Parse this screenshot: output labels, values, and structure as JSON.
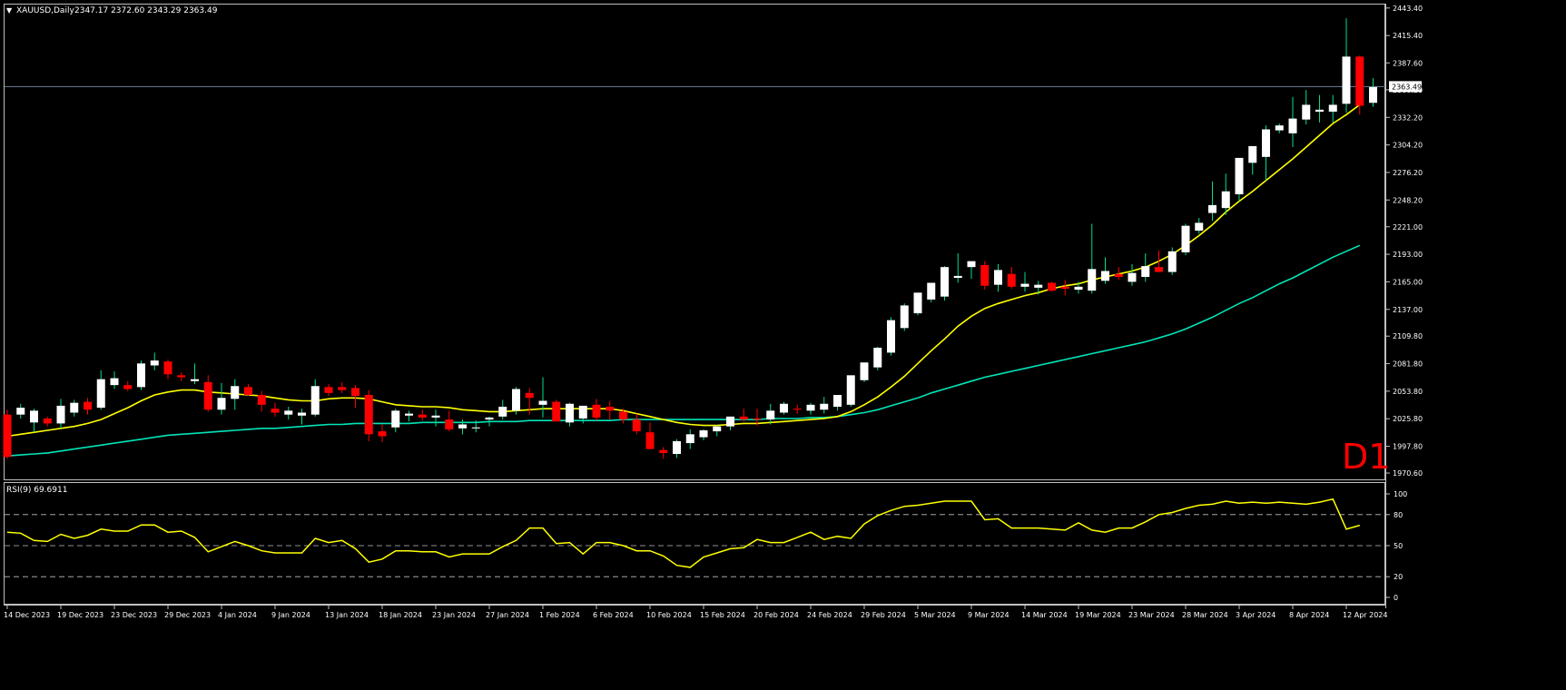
{
  "header": {
    "arrow": "▼",
    "symbol_tf": "XAUUSD,Daily",
    "ohlc_values": "2347.17 2372.60 2343.29 2363.49"
  },
  "watermark": "D1",
  "rsi_label": "RSI(9) 69.6911",
  "colors": {
    "background": "#000000",
    "axis": "#c0c0c0",
    "bear": "#ff0000",
    "bull": "#ffffff",
    "ma_fast": "#ffff00",
    "ma_slow": "#00e5b8",
    "rsi": "#ffff00",
    "price_line": "#6b7f99",
    "watermark": "#ff0000"
  },
  "chart_data": {
    "type": "candlestick",
    "symbol": "XAUUSD",
    "timeframe": "Daily",
    "last_price": 2363.49,
    "y_ticks": [
      1970.6,
      1997.8,
      2025.8,
      2053.8,
      2081.8,
      2109.8,
      2137.0,
      2165.0,
      2193.0,
      2221.0,
      2248.2,
      2276.2,
      2304.2,
      2332.2,
      2360.2,
      2387.6,
      2415.4,
      2443.4
    ],
    "ylim": [
      1966,
      2446
    ],
    "x_tick_labels": [
      {
        "i": 0,
        "label": "14 Dec 2023"
      },
      {
        "i": 4,
        "label": "19 Dec 2023"
      },
      {
        "i": 8,
        "label": "23 Dec 2023"
      },
      {
        "i": 12,
        "label": "29 Dec 2023"
      },
      {
        "i": 16,
        "label": "4 Jan 2024"
      },
      {
        "i": 20,
        "label": "9 Jan 2024"
      },
      {
        "i": 24,
        "label": "13 Jan 2024"
      },
      {
        "i": 28,
        "label": "18 Jan 2024"
      },
      {
        "i": 32,
        "label": "23 Jan 2024"
      },
      {
        "i": 36,
        "label": "27 Jan 2024"
      },
      {
        "i": 40,
        "label": "1 Feb 2024"
      },
      {
        "i": 44,
        "label": "6 Feb 2024"
      },
      {
        "i": 48,
        "label": "10 Feb 2024"
      },
      {
        "i": 52,
        "label": "15 Feb 2024"
      },
      {
        "i": 56,
        "label": "20 Feb 2024"
      },
      {
        "i": 60,
        "label": "24 Feb 2024"
      },
      {
        "i": 64,
        "label": "29 Feb 2024"
      },
      {
        "i": 68,
        "label": "5 Mar 2024"
      },
      {
        "i": 72,
        "label": "9 Mar 2024"
      },
      {
        "i": 76,
        "label": "14 Mar 2024"
      },
      {
        "i": 80,
        "label": "19 Mar 2024"
      },
      {
        "i": 84,
        "label": "23 Mar 2024"
      },
      {
        "i": 88,
        "label": "28 Mar 2024"
      },
      {
        "i": 92,
        "label": "3 Apr 2024"
      },
      {
        "i": 96,
        "label": "8 Apr 2024"
      },
      {
        "i": 100,
        "label": "12 Apr 2024"
      }
    ],
    "candles": [
      [
        2030,
        2035,
        1985,
        1987
      ],
      [
        2030,
        2041,
        2026,
        2037
      ],
      [
        2022,
        2036,
        2012,
        2034
      ],
      [
        2026,
        2028,
        2018,
        2021
      ],
      [
        2021,
        2046,
        2016,
        2039
      ],
      [
        2032,
        2045,
        2028,
        2042
      ],
      [
        2043,
        2047,
        2030,
        2035
      ],
      [
        2037,
        2075,
        2035,
        2066
      ],
      [
        2060,
        2074,
        2056,
        2067
      ],
      [
        2060,
        2064,
        2054,
        2056
      ],
      [
        2058,
        2085,
        2055,
        2082
      ],
      [
        2080,
        2093,
        2075,
        2085
      ],
      [
        2084,
        2086,
        2066,
        2071
      ],
      [
        2070,
        2073,
        2064,
        2068
      ],
      [
        2064,
        2082,
        2061,
        2066
      ],
      [
        2063,
        2070,
        2033,
        2035
      ],
      [
        2035,
        2062,
        2030,
        2047
      ],
      [
        2046,
        2066,
        2035,
        2059
      ],
      [
        2058,
        2061,
        2049,
        2050
      ],
      [
        2050,
        2054,
        2033,
        2040
      ],
      [
        2036,
        2042,
        2028,
        2032
      ],
      [
        2030,
        2038,
        2025,
        2034
      ],
      [
        2029,
        2036,
        2020,
        2032
      ],
      [
        2030,
        2066,
        2028,
        2059
      ],
      [
        2058,
        2061,
        2049,
        2052
      ],
      [
        2058,
        2063,
        2052,
        2055
      ],
      [
        2057,
        2060,
        2037,
        2049
      ],
      [
        2050,
        2055,
        2003,
        2010
      ],
      [
        2013,
        2020,
        2002,
        2008
      ],
      [
        2017,
        2036,
        2012,
        2034
      ],
      [
        2029,
        2034,
        2023,
        2031
      ],
      [
        2030,
        2035,
        2024,
        2027
      ],
      [
        2027,
        2035,
        2018,
        2029
      ],
      [
        2025,
        2034,
        2013,
        2015
      ],
      [
        2016,
        2025,
        2010,
        2020
      ],
      [
        2016,
        2024,
        2012,
        2017
      ],
      [
        2025,
        2028,
        2018,
        2027
      ],
      [
        2028,
        2045,
        2025,
        2038
      ],
      [
        2034,
        2058,
        2030,
        2056
      ],
      [
        2052,
        2057,
        2030,
        2047
      ],
      [
        2040,
        2068,
        2027,
        2044
      ],
      [
        2043,
        2045,
        2025,
        2023
      ],
      [
        2022,
        2042,
        2018,
        2041
      ],
      [
        2026,
        2037,
        2021,
        2039
      ],
      [
        2040,
        2046,
        2024,
        2027
      ],
      [
        2038,
        2044,
        2025,
        2034
      ],
      [
        2033,
        2036,
        2021,
        2025
      ],
      [
        2025,
        2031,
        2010,
        2013
      ],
      [
        2012,
        2022,
        1996,
        1995
      ],
      [
        1994,
        1997,
        1985,
        1991
      ],
      [
        1990,
        2005,
        1986,
        2003
      ],
      [
        2001,
        2015,
        1995,
        2010
      ],
      [
        2007,
        2015,
        2004,
        2014
      ],
      [
        2013,
        2019,
        2008,
        2018
      ],
      [
        2018,
        2028,
        2014,
        2028
      ],
      [
        2028,
        2036,
        2023,
        2025
      ],
      [
        2026,
        2036,
        2019,
        2025
      ],
      [
        2025,
        2041,
        2020,
        2034
      ],
      [
        2032,
        2043,
        2030,
        2041
      ],
      [
        2036,
        2040,
        2031,
        2035
      ],
      [
        2034,
        2042,
        2030,
        2040
      ],
      [
        2035,
        2048,
        2031,
        2041
      ],
      [
        2038,
        2050,
        2034,
        2050
      ],
      [
        2040,
        2060,
        2038,
        2070
      ],
      [
        2065,
        2083,
        2063,
        2083
      ],
      [
        2078,
        2099,
        2075,
        2098
      ],
      [
        2093,
        2129,
        2090,
        2126
      ],
      [
        2118,
        2143,
        2115,
        2141
      ],
      [
        2133,
        2153,
        2131,
        2154
      ],
      [
        2147,
        2162,
        2144,
        2164
      ],
      [
        2150,
        2181,
        2146,
        2180
      ],
      [
        2169,
        2194,
        2164,
        2171
      ],
      [
        2180,
        2183,
        2168,
        2186
      ],
      [
        2182,
        2186,
        2157,
        2161
      ],
      [
        2162,
        2183,
        2155,
        2177
      ],
      [
        2173,
        2180,
        2158,
        2160
      ],
      [
        2160,
        2175,
        2155,
        2163
      ],
      [
        2159,
        2166,
        2152,
        2162
      ],
      [
        2164,
        2165,
        2155,
        2156
      ],
      [
        2160,
        2167,
        2151,
        2158
      ],
      [
        2157,
        2165,
        2153,
        2160
      ],
      [
        2156,
        2224,
        2153,
        2178
      ],
      [
        2166,
        2190,
        2163,
        2176
      ],
      [
        2173,
        2180,
        2167,
        2170
      ],
      [
        2165,
        2183,
        2161,
        2174
      ],
      [
        2170,
        2194,
        2165,
        2181
      ],
      [
        2180,
        2197,
        2175,
        2175
      ],
      [
        2175,
        2200,
        2172,
        2196
      ],
      [
        2195,
        2224,
        2192,
        2222
      ],
      [
        2217,
        2230,
        2214,
        2225
      ],
      [
        2235,
        2267,
        2227,
        2243
      ],
      [
        2240,
        2275,
        2233,
        2257
      ],
      [
        2254,
        2288,
        2247,
        2291
      ],
      [
        2286,
        2300,
        2274,
        2303
      ],
      [
        2292,
        2324,
        2268,
        2320
      ],
      [
        2319,
        2326,
        2316,
        2324
      ],
      [
        2316,
        2353,
        2302,
        2331
      ],
      [
        2330,
        2360,
        2325,
        2345
      ],
      [
        2338,
        2355,
        2327,
        2340
      ],
      [
        2338,
        2355,
        2327,
        2345
      ],
      [
        2346,
        2433,
        2337,
        2394
      ],
      [
        2394,
        2395,
        2335,
        2344
      ],
      [
        2347,
        2372,
        2343,
        2363
      ]
    ],
    "ma_fast": [
      2008,
      2010,
      2012,
      2014,
      2016,
      2018,
      2021,
      2025,
      2031,
      2037,
      2044,
      2050,
      2053,
      2055,
      2055,
      2053,
      2052,
      2051,
      2050,
      2049,
      2047,
      2045,
      2044,
      2044,
      2046,
      2047,
      2047,
      2046,
      2043,
      2040,
      2039,
      2038,
      2038,
      2037,
      2035,
      2034,
      2033,
      2033,
      2034,
      2035,
      2036,
      2036,
      2036,
      2036,
      2036,
      2036,
      2034,
      2031,
      2028,
      2025,
      2022,
      2020,
      2019,
      2019,
      2020,
      2021,
      2021,
      2022,
      2023,
      2024,
      2025,
      2026,
      2028,
      2033,
      2040,
      2048,
      2058,
      2069,
      2082,
      2095,
      2107,
      2120,
      2130,
      2138,
      2143,
      2147,
      2151,
      2154,
      2158,
      2161,
      2163,
      2167,
      2170,
      2173,
      2176,
      2180,
      2186,
      2193,
      2202,
      2212,
      2223,
      2236,
      2247,
      2257,
      2268,
      2279,
      2290,
      2302,
      2314,
      2326,
      2335,
      2345
    ],
    "ma_slow": [
      1988,
      1989,
      1990,
      1991,
      1993,
      1995,
      1997,
      1999,
      2001,
      2003,
      2005,
      2007,
      2009,
      2010,
      2011,
      2012,
      2013,
      2014,
      2015,
      2016,
      2016,
      2017,
      2018,
      2019,
      2020,
      2020,
      2021,
      2021,
      2021,
      2021,
      2021,
      2022,
      2022,
      2022,
      2022,
      2022,
      2023,
      2023,
      2023,
      2024,
      2024,
      2024,
      2024,
      2024,
      2024,
      2024,
      2025,
      2025,
      2025,
      2025,
      2025,
      2025,
      2025,
      2025,
      2025,
      2025,
      2025,
      2026,
      2026,
      2026,
      2027,
      2027,
      2028,
      2030,
      2032,
      2035,
      2039,
      2043,
      2047,
      2052,
      2056,
      2060,
      2064,
      2068,
      2071,
      2074,
      2077,
      2080,
      2083,
      2086,
      2089,
      2092,
      2095,
      2098,
      2101,
      2104,
      2108,
      2112,
      2117,
      2123,
      2129,
      2136,
      2143,
      2149,
      2156,
      2163,
      2169,
      2176,
      2183,
      2190,
      2196,
      2202
    ],
    "rsi": {
      "label": "RSI(9)",
      "last": 69.6911,
      "levels": [
        80,
        50,
        20
      ],
      "ticks": [
        100,
        80,
        50,
        20,
        0
      ],
      "values": [
        63,
        62,
        55,
        54,
        61,
        57,
        60,
        66,
        64,
        64,
        70,
        70,
        63,
        64,
        58,
        44,
        49,
        54,
        50,
        45,
        43,
        43,
        43,
        57,
        53,
        55,
        47,
        34,
        37,
        45,
        45,
        44,
        44,
        39,
        42,
        42,
        42,
        49,
        55,
        67,
        67,
        52,
        53,
        42,
        53,
        53,
        50,
        45,
        45,
        40,
        31,
        29,
        39,
        43,
        47,
        48,
        56,
        53,
        53,
        58,
        63,
        56,
        59,
        57,
        71,
        79,
        84,
        88,
        89,
        91,
        93,
        93,
        93,
        75,
        76,
        67,
        67,
        67,
        66,
        65,
        72,
        65,
        63,
        67,
        67,
        73,
        80,
        82,
        86,
        89,
        90,
        93,
        91,
        92,
        91,
        92,
        91,
        90,
        92,
        95,
        66,
        69.69
      ]
    }
  }
}
